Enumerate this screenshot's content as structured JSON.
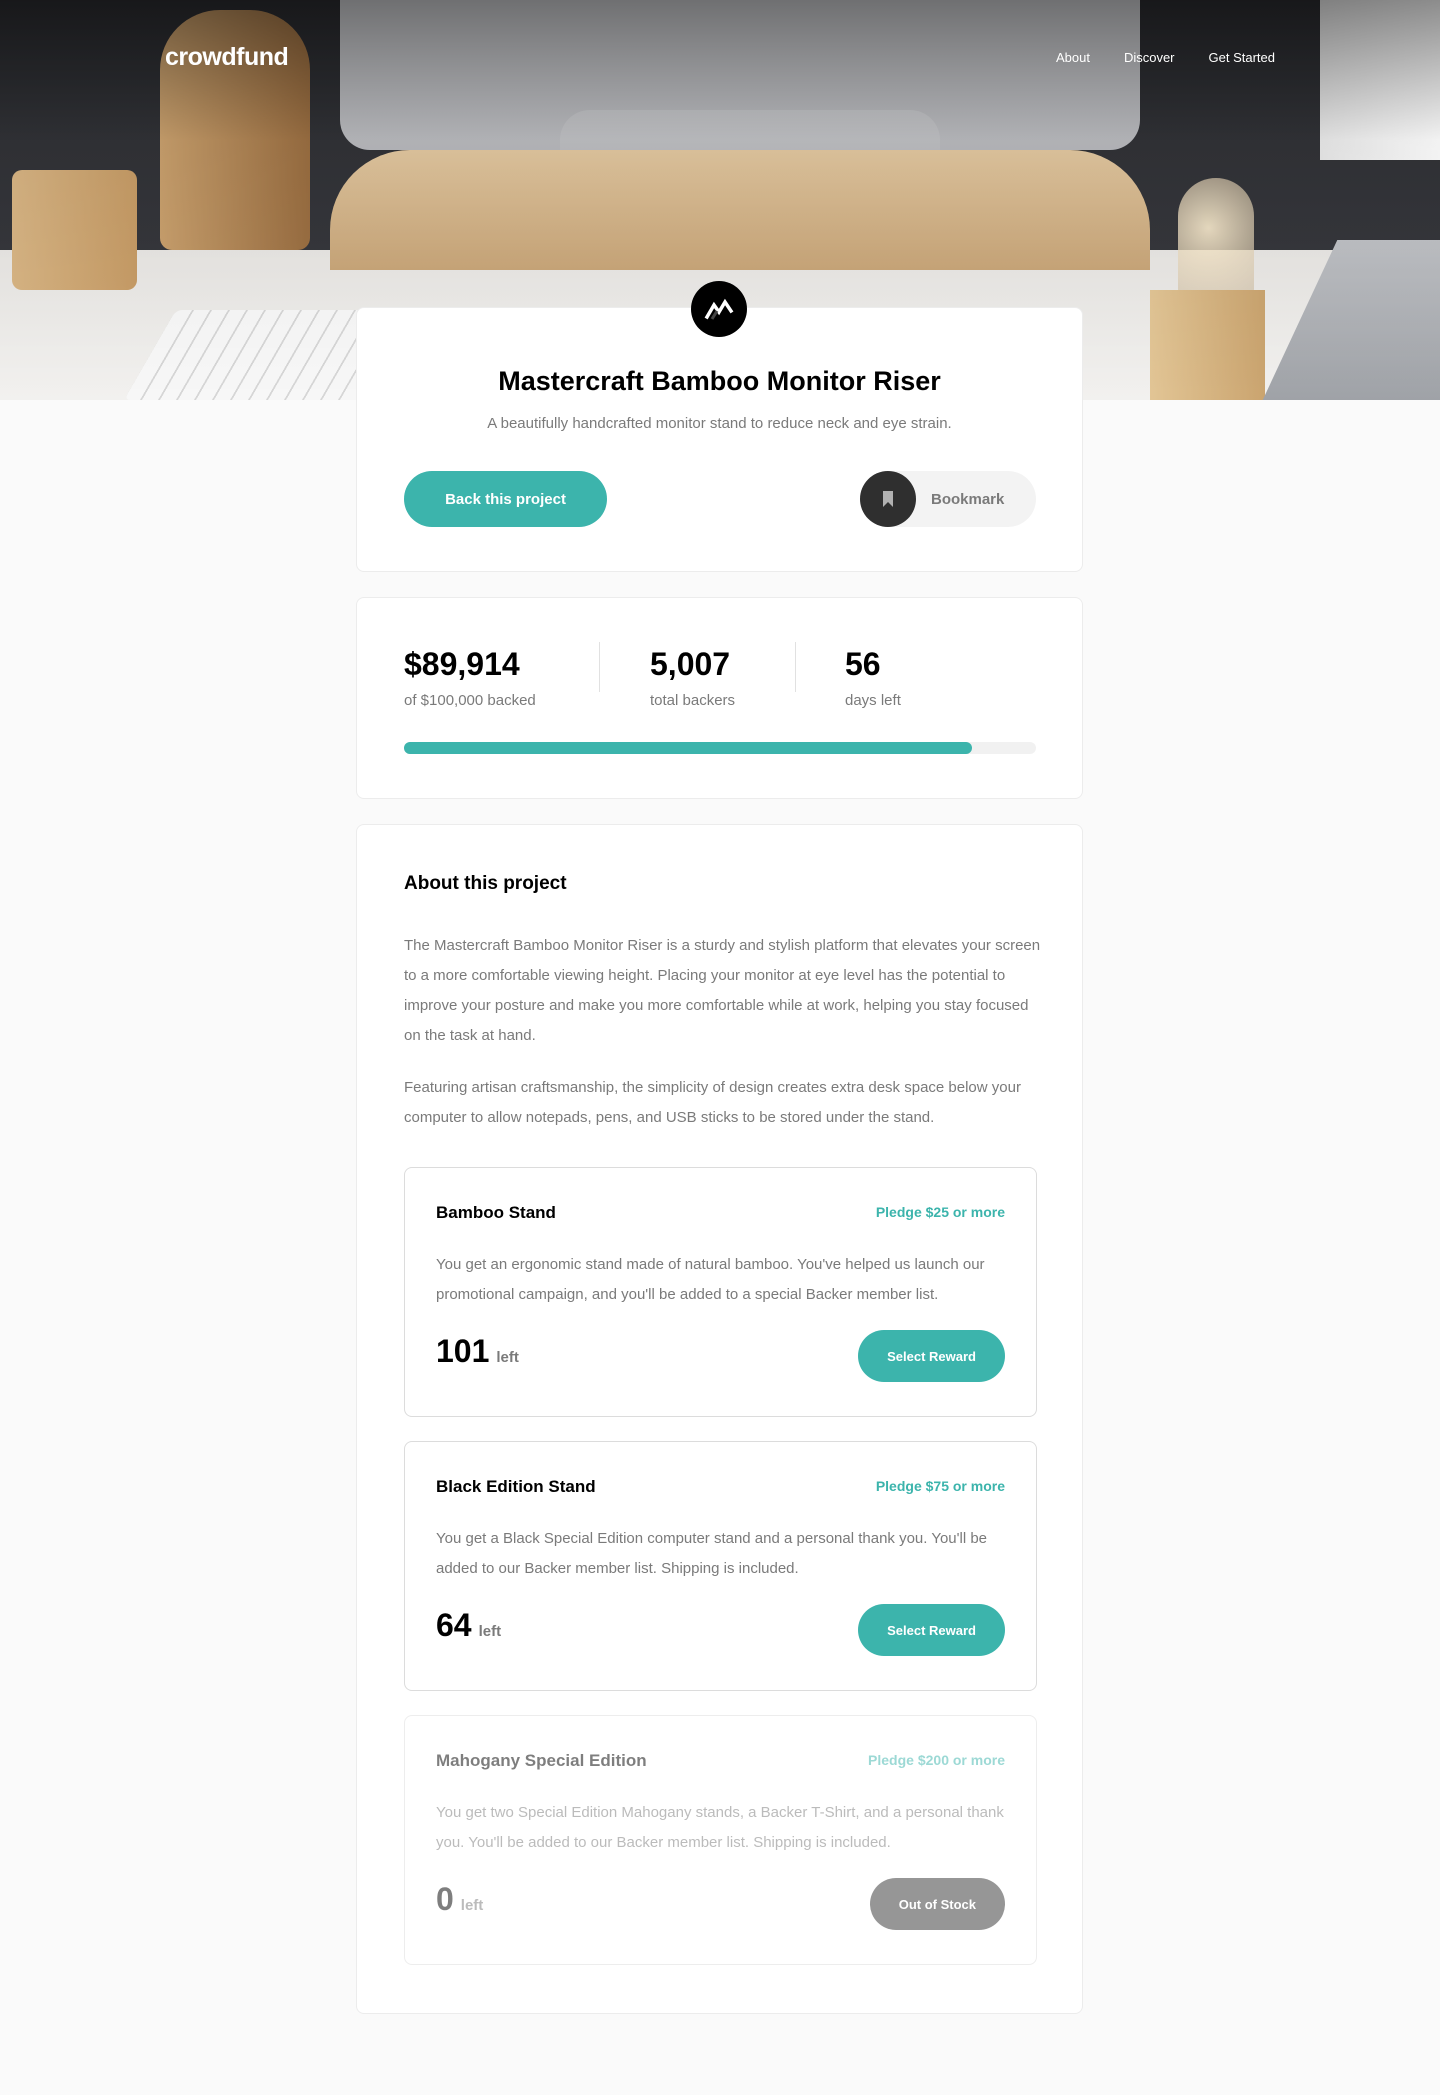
{
  "header": {
    "logo": "crowdfund",
    "nav": [
      "About",
      "Discover",
      "Get Started"
    ]
  },
  "intro": {
    "icon": "mastercraft-logo-icon",
    "title": "Mastercraft Bamboo Monitor Riser",
    "subtitle": "A beautifully handcrafted monitor stand to reduce neck and eye strain.",
    "back_label": "Back this project",
    "bookmark_label": "Bookmark"
  },
  "stats": {
    "backed": {
      "value": "$89,914",
      "label": "of $100,000 backed"
    },
    "backers": {
      "value": "5,007",
      "label": "total backers"
    },
    "days": {
      "value": "56",
      "label": "days left"
    },
    "progress_fraction": 0.899
  },
  "about": {
    "title": "About this project",
    "paragraphs": [
      "The Mastercraft Bamboo Monitor Riser is a sturdy and stylish platform that elevates your screen to a more comfortable viewing height. Placing your monitor at eye level has the potential to improve your posture and make you more comfortable while at work, helping you stay focused on the task at hand.",
      "Featuring artisan craftsmanship, the simplicity of design creates extra desk space below your computer to allow notepads, pens, and USB sticks to be stored under the stand."
    ],
    "rewards": [
      {
        "title": "Bamboo Stand",
        "pledge": "Pledge $25 or more",
        "description": "You get an ergonomic stand made of natural bamboo. You've helped us launch our promotional campaign, and you'll be added to a special Backer member list.",
        "left": "101",
        "left_word": "left",
        "button": "Select Reward"
      },
      {
        "title": "Black Edition Stand",
        "pledge": "Pledge $75 or more",
        "description": "You get a Black Special Edition computer stand and a personal thank you. You'll be added to our Backer member list. Shipping is included.",
        "left": "64",
        "left_word": "left",
        "button": "Select Reward"
      },
      {
        "title": "Mahogany Special Edition",
        "pledge": "Pledge $200 or more",
        "description": "You get two Special Edition Mahogany stands, a Backer T-Shirt, and a personal thank you. You'll be added to our Backer member list. Shipping is included.",
        "left": "0",
        "left_word": "left",
        "button": "Out of Stock"
      }
    ]
  },
  "colors": {
    "accent": "#3cb4ac",
    "dark": "#2f2f2f",
    "muted_text": "#7a7a7a",
    "background": "#fafafa"
  }
}
